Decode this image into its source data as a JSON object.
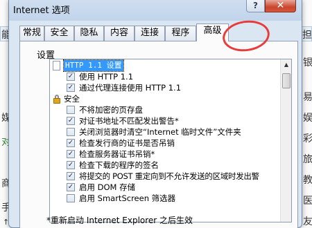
{
  "window": {
    "title": "Internet 选项",
    "help_label": "?",
    "close_label": "✕"
  },
  "background": {
    "left_chars": [
      "能",
      "媒",
      "对",
      "商",
      "手",
      "↑"
    ],
    "right_chars": [
      "担",
      "银",
      "易",
      "娱",
      "彩",
      "旅",
      "教",
      "医",
      "友"
    ]
  },
  "tabs": [
    "常规",
    "安全",
    "隐私",
    "内容",
    "连接",
    "程序",
    "高级"
  ],
  "active_tab": "高级",
  "group_label": "设置",
  "tree": {
    "rows": [
      {
        "label": "HTTP 1.1 设置",
        "type": "header-doc",
        "selected": true
      },
      {
        "label": "使用 HTTP 1.1",
        "type": "check",
        "checked": true
      },
      {
        "label": "通过代理连接使用 HTTP 1.1",
        "type": "check",
        "checked": true
      },
      {
        "label": "安全",
        "type": "header-lock"
      },
      {
        "label": "不将加密的页存盘",
        "type": "check",
        "checked": false
      },
      {
        "label": "对证书地址不匹配发出警告*",
        "type": "check",
        "checked": true
      },
      {
        "label": "关闭浏览器时清空“Internet 临时文件”文件夹",
        "type": "check",
        "checked": false
      },
      {
        "label": "检查发行商的证书是否吊销",
        "type": "check",
        "checked": true
      },
      {
        "label": "检查服务器证书吊销*",
        "type": "check",
        "checked": true
      },
      {
        "label": "检查下载的程序的签名",
        "type": "check",
        "checked": true
      },
      {
        "label": "将提交的 POST 重定向到不允许发送的区域时发出警",
        "type": "check",
        "checked": true
      },
      {
        "label": "启用 DOM 存储",
        "type": "check",
        "checked": true
      },
      {
        "label": "启用 SmartScreen 筛选器",
        "type": "check",
        "checked": false
      }
    ]
  },
  "footnote": "*重新启动 Internet Explorer 之后生效",
  "icons": {
    "scroll_up": "▲"
  },
  "colors": {
    "annotation": "#e83c3c",
    "selection": "#3399ff"
  }
}
